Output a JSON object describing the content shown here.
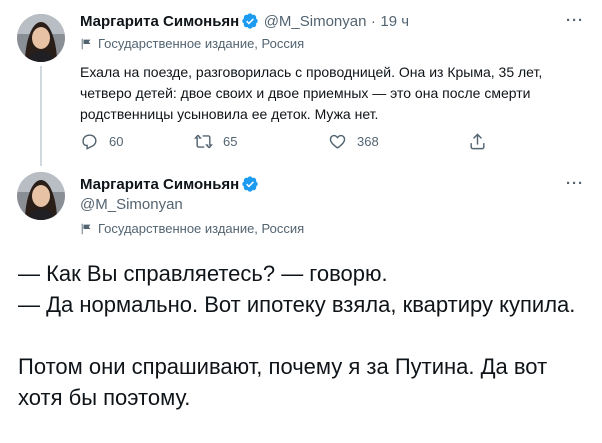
{
  "tweet1": {
    "author_name": "Маргарита Симоньян",
    "handle": "@M_Simonyan",
    "separator": "·",
    "time": "19 ч",
    "label": "Государственное издание, Россия",
    "text": "Ехала на поезде, разговорилась с проводницей. Она из Крыма, 35 лет, четверо детей: двое своих и двое приемных — это она после смерти родственницы усыновила ее деток. Мужа нет.",
    "replies": "60",
    "retweets": "65",
    "likes": "368",
    "more": "···"
  },
  "tweet2": {
    "author_name": "Маргарита Симоньян",
    "handle": "@M_Simonyan",
    "label": "Государственное издание, Россия",
    "more": "···",
    "lines": [
      "— Как Вы справляетесь? — говорю.",
      "— Да нормально. Вот ипотеку взяла, квартиру купила.",
      "Потом они спрашивают, почему я за Путина. Да вот хотя бы поэтому."
    ]
  },
  "colors": {
    "verified": "#1d9bf0",
    "muted": "#536471",
    "text": "#0f1419"
  }
}
